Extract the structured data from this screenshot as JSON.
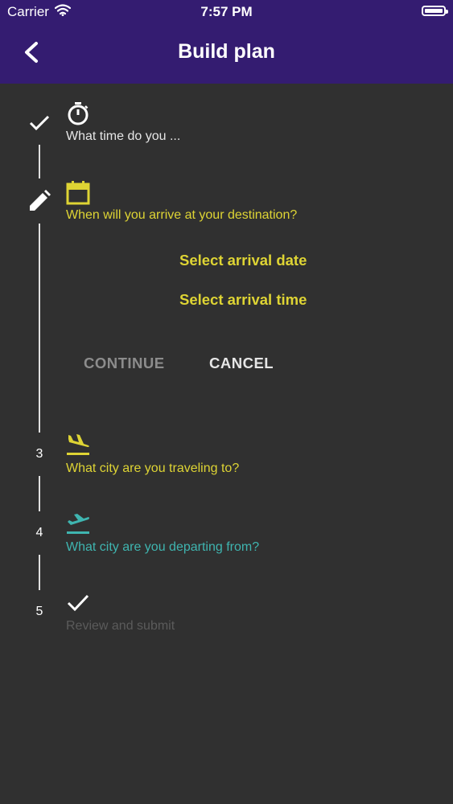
{
  "status_bar": {
    "carrier": "Carrier",
    "time": "7:57 PM"
  },
  "nav": {
    "title": "Build plan",
    "back_icon": "chevron-left-icon"
  },
  "colors": {
    "header": "#341c71",
    "background": "#303030",
    "accent_yellow": "#ded434",
    "accent_teal": "#3fb5b0",
    "disabled": "#5b5b5b"
  },
  "steps": [
    {
      "marker": "check",
      "icon": "timer-icon",
      "text": "What time do you ..."
    },
    {
      "marker": "edit",
      "icon": "calendar-icon",
      "text": "When will you arrive at your destination?"
    },
    {
      "marker": "3",
      "icon": "flight-land-icon",
      "text": "What city are you traveling to?"
    },
    {
      "marker": "4",
      "icon": "flight-takeoff-icon",
      "text": "What city are you departing from?"
    },
    {
      "marker": "5",
      "icon": "check-icon",
      "text": "Review and submit"
    }
  ],
  "active_step": {
    "select_date": "Select arrival date",
    "select_time": "Select arrival time",
    "continue_label": "CONTINUE",
    "cancel_label": "CANCEL"
  }
}
